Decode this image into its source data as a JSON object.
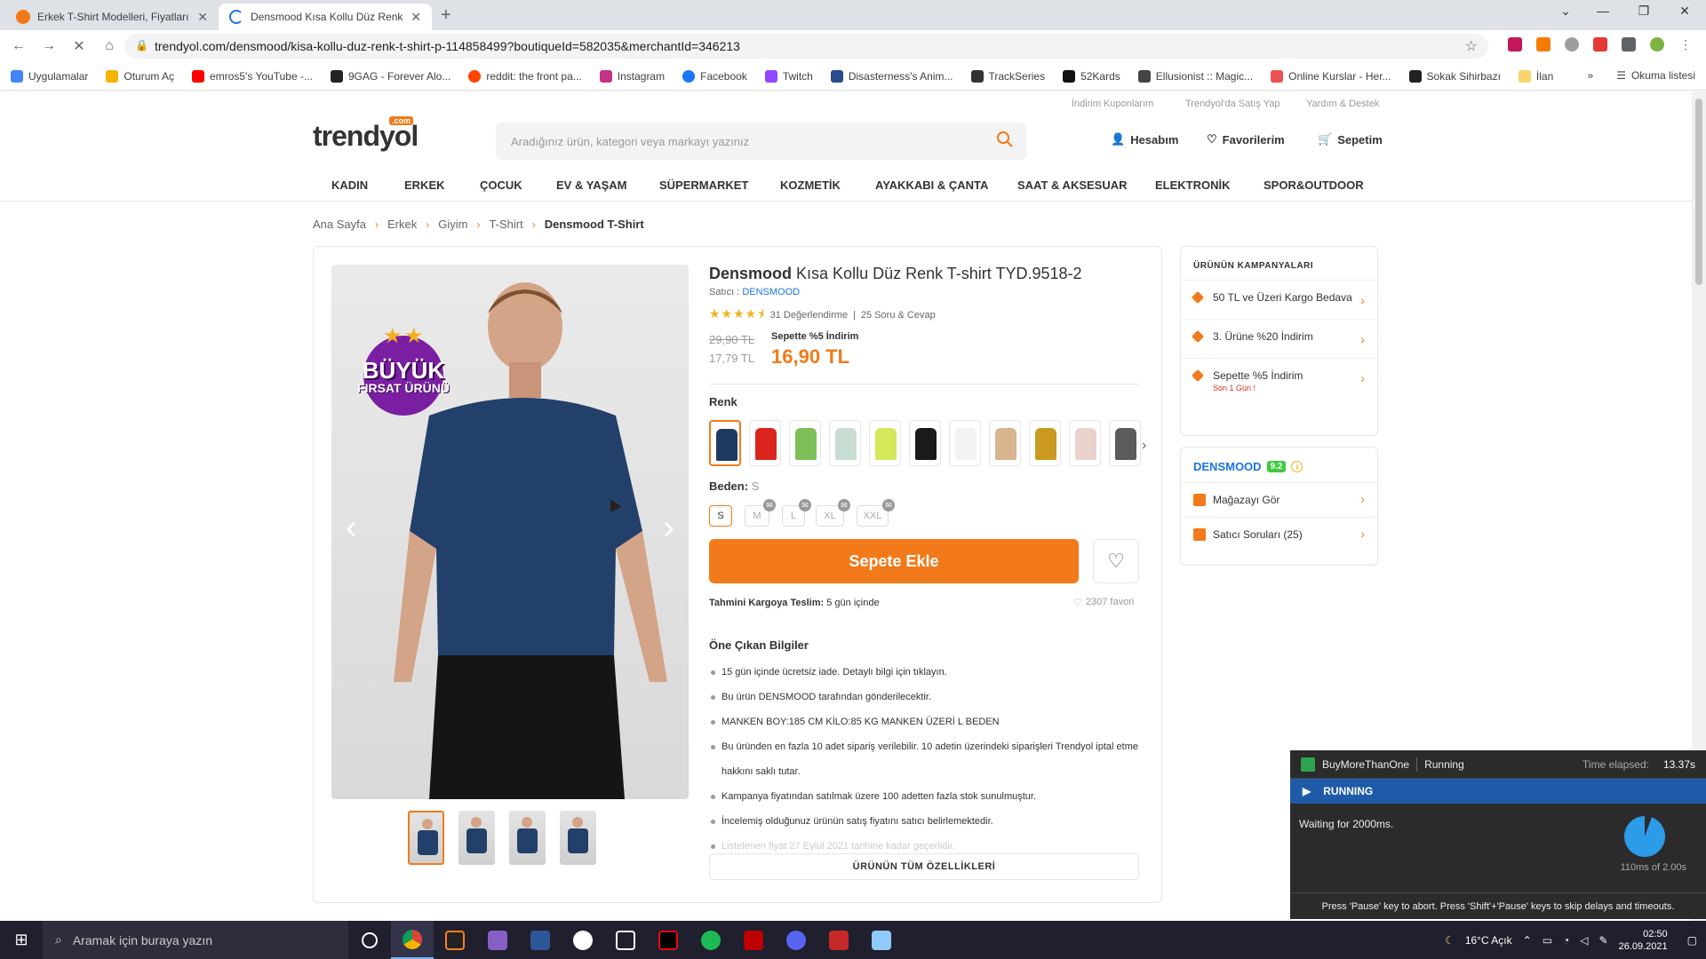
{
  "browser": {
    "tabs": [
      {
        "title": "Erkek T-Shirt Modelleri, Fiyatları",
        "active": false
      },
      {
        "title": "Densmood Kısa Kollu Düz Renk T",
        "active": true
      }
    ],
    "url": "trendyol.com/densmood/kisa-kollu-duz-renk-t-shirt-p-114858499?boutiqueId=582035&merchantId=346213",
    "bookmarks": [
      "Uygulamalar",
      "Oturum Aç",
      "emros5's YouTube -...",
      "9GAG - Forever Alo...",
      "reddit: the front pa...",
      "Instagram",
      "Facebook",
      "Twitch",
      "Disasterness's Anim...",
      "TrackSeries",
      "52Kards",
      "Ellusionist :: Magic...",
      "Online Kurslar - Her...",
      "Sokak Sihirbazı",
      "İlan"
    ],
    "more_bookmarks": "»",
    "reading_list": "Okuma listesi"
  },
  "site": {
    "top_links": [
      "İndirim Kuponlarım",
      "Trendyol'da Satış Yap",
      "Yardım & Destek"
    ],
    "logo": "trendyol",
    "logo_com": ".com",
    "search_placeholder": "Aradığınız ürün, kategori veya markayı yazınız",
    "account": "Hesabım",
    "favorites": "Favorilerim",
    "cart": "Sepetim",
    "categories": [
      "KADIN",
      "ERKEK",
      "ÇOCUK",
      "EV & YAŞAM",
      "SÜPERMARKET",
      "KOZMETİK",
      "AYAKKABI & ÇANTA",
      "SAAT & AKSESUAR",
      "ELEKTRONİK",
      "SPOR&OUTDOOR"
    ]
  },
  "breadcrumb": [
    "Ana Sayfa",
    "Erkek",
    "Giyim",
    "T-Shirt",
    "Densmood T-Shirt"
  ],
  "product": {
    "brand": "Densmood",
    "name": "Kısa Kollu Düz Renk T-shirt TYD.9518-2",
    "seller_label": "Satıcı :",
    "seller": "DENSMOOD",
    "rating": 4.5,
    "reviews": "31 Değerlendirme",
    "qa": "25 Soru & Cevap",
    "old_price": "29,90 TL",
    "base_price": "17,79 TL",
    "discount_label": "Sepette %5 İndirim",
    "price": "16,90 TL",
    "badge_line1": "BÜYÜK",
    "badge_line2": "FIRSAT ÜRÜNÜ",
    "color_label": "Renk",
    "colors": [
      "#1f3a5f",
      "#d9251d",
      "#7fbf5a",
      "#c8ddd2",
      "#d4e85a",
      "#1a1a1a",
      "#f3f3f3",
      "#d8b48f",
      "#c99a1f",
      "#e9d2cc",
      "#5b5b5b"
    ],
    "size_label": "Beden:",
    "size_selected": "S",
    "sizes": [
      "S",
      "M",
      "L",
      "XL",
      "XXL"
    ],
    "add_to_cart": "Sepete Ekle",
    "delivery_label": "Tahmini Kargoya Teslim:",
    "delivery_value": "5 gün içinde",
    "fav_count": "2307 favori",
    "highlights_title": "Öne Çıkan Bilgiler",
    "highlights": [
      "15 gün içinde ücretsiz iade. Detaylı bilgi için tıklayın.",
      "Bu ürün DENSMOOD tarafından gönderilecektir.",
      "MANKEN BOY:185 CM KİLO:85 KG MANKEN ÜZERİ L BEDEN",
      "Bu üründen en fazla 10 adet sipariş verilebilir. 10 adetin üzerindeki siparişleri Trendyol iptal etme hakkını saklı tutar.",
      "Kampanya fiyatından satılmak üzere 100 adetten fazla stok sunulmuştur.",
      "İncelemiş olduğunuz ürünün satış fiyatını satıcı belirlemektedir.",
      "Listelenen fiyat 27 Eylül 2021 tarihine kadar geçerlidir."
    ],
    "all_features": "ÜRÜNÜN TÜM ÖZELLİKLERİ"
  },
  "campaigns": {
    "title": "ÜRÜNÜN KAMPANYALARI",
    "items": [
      {
        "label": "50 TL ve Üzeri Kargo Bedava",
        "sub": ""
      },
      {
        "label": "3. Ürüne %20 İndirim",
        "sub": ""
      },
      {
        "label": "Sepette %5 İndirim",
        "sub": "Son 1 Gün !"
      }
    ]
  },
  "seller_box": {
    "name": "DENSMOOD",
    "score": "9.2",
    "store": "Mağazayı Gör",
    "questions": "Satıcı Soruları (25)"
  },
  "overlay": {
    "app": "BuyMoreThanOne",
    "state": "Running",
    "elapsed_label": "Time elapsed:",
    "elapsed": "13.37s",
    "banner": "RUNNING",
    "waiting": "Waiting for 2000ms.",
    "progress_fraction": 0.055,
    "progress_text": "110ms of 2.00s",
    "footer": "Press 'Pause' key to abort. Press 'Shift'+'Pause' keys to skip delays and timeouts."
  },
  "taskbar": {
    "search": "Aramak için buraya yazın",
    "weather": "16°C  Açık",
    "time": "02:50",
    "date": "26.09.2021"
  }
}
